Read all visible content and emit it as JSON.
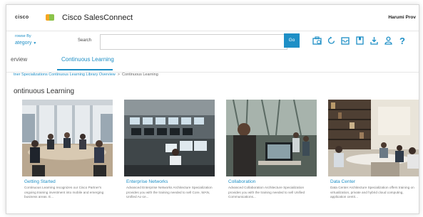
{
  "header": {
    "logo": "cisco",
    "app_title": "Cisco SalesConnect",
    "user_name": "Harumi Prov"
  },
  "browse": {
    "line1": "rowse By",
    "line2": "ategory"
  },
  "search": {
    "label": "Search",
    "placeholder": "",
    "go_label": "Go"
  },
  "toolbar_icons": [
    "briefcase-icon",
    "refresh-icon",
    "inbox-icon",
    "bookmark-icon",
    "download-icon",
    "user-icon",
    "help-icon"
  ],
  "help_glyph": "?",
  "tabs": [
    {
      "label": "erview"
    },
    {
      "label": "Continuous Learning"
    }
  ],
  "breadcrumb": {
    "link": "tner Specializations Continuous Learning Library Overview",
    "separator": ">",
    "current": "Continuous Learning"
  },
  "page_title": "ontinuous Learning",
  "cards": [
    {
      "title": "Getting Started",
      "description": "Continuous Learning recognizes our Cisco Partner's ongoing training investment into mobile and emerging business areas. E..."
    },
    {
      "title": "Enterprise Networks",
      "description": "Advanced Enterprise Networks Architecture Specialization provides you with the training needed to sell Core, WAN, Unified Ac-ce..."
    },
    {
      "title": "Collaboration",
      "description": "Advanced Collaboration Architecture Specialization provides you with the training needed to sell Unified Communications..."
    },
    {
      "title": "Data Center",
      "description": "Data Center Architecture Specialization offers training on virtualization, private and hybrid cloud computing, application centri..."
    }
  ],
  "colors": {
    "accent": "#1e8fc6",
    "logo_orange": "#f5a623",
    "logo_green": "#8bc34a"
  }
}
